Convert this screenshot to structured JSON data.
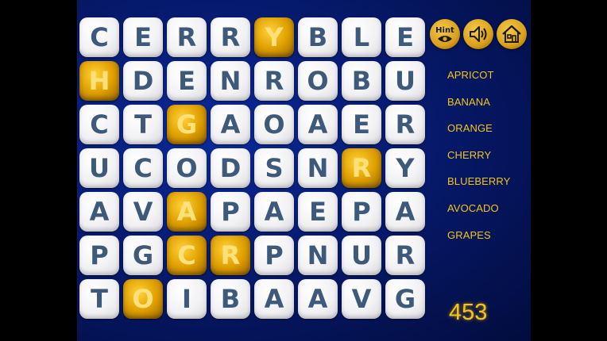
{
  "grid": {
    "rows": [
      [
        "C",
        "E",
        "R",
        "R",
        "Y",
        "B",
        "L",
        "E"
      ],
      [
        "H",
        "D",
        "E",
        "N",
        "R",
        "O",
        "B",
        "U"
      ],
      [
        "C",
        "T",
        "G",
        "A",
        "O",
        "A",
        "E",
        "R"
      ],
      [
        "U",
        "C",
        "O",
        "D",
        "S",
        "N",
        "R",
        "Y"
      ],
      [
        "A",
        "V",
        "A",
        "P",
        "A",
        "E",
        "P",
        "A"
      ],
      [
        "P",
        "G",
        "C",
        "R",
        "P",
        "N",
        "U",
        "R"
      ],
      [
        "T",
        "O",
        "I",
        "B",
        "A",
        "A",
        "V",
        "G"
      ]
    ],
    "selected": [
      [
        0,
        4
      ],
      [
        1,
        0
      ],
      [
        2,
        2
      ],
      [
        3,
        6
      ],
      [
        4,
        2
      ],
      [
        5,
        2
      ],
      [
        5,
        3
      ],
      [
        6,
        1
      ]
    ]
  },
  "controls": {
    "hint_label": "Hint",
    "hint_icon": "eye-icon",
    "sound_icon": "speaker-icon",
    "home_icon": "house-icon"
  },
  "word_list": [
    "APRICOT",
    "BANANA",
    "ORANGE",
    "CHERRY",
    "BLUEBERRY",
    "AVOCADO",
    "GRAPES"
  ],
  "score": "453",
  "colors": {
    "background": "#061a6e",
    "tile": "#f2f2f4",
    "tile_letter": "#3d5a7a",
    "selected_tile": "#e0a000",
    "selected_letter": "#ffe07a",
    "accent_text": "#f2c51c"
  }
}
